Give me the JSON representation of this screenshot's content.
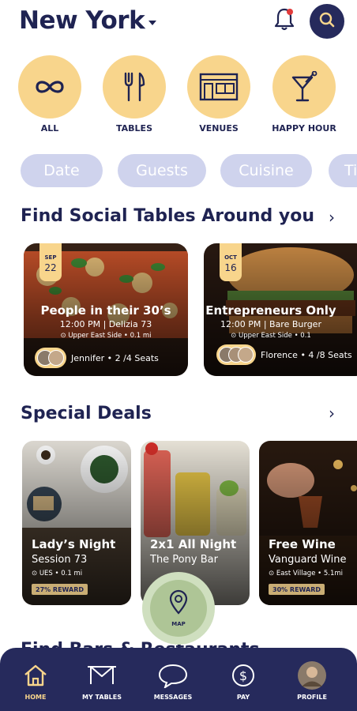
{
  "header": {
    "city": "New York"
  },
  "categories": [
    {
      "label": "ALL",
      "icon": "infinity-icon"
    },
    {
      "label": "TABLES",
      "icon": "fork-knife-icon"
    },
    {
      "label": "VENUES",
      "icon": "storefront-icon"
    },
    {
      "label": "HAPPY HOUR",
      "icon": "cocktail-icon"
    }
  ],
  "filters": [
    "Date",
    "Guests",
    "Cuisine",
    "Ti"
  ],
  "social_tables": {
    "title": "Find Social Tables Around you",
    "cards": [
      {
        "month": "SEP",
        "day": "22",
        "title": "People in their 30’s",
        "time_venue": "12:00 PM | Delizia 73",
        "location": "Upper East Side • 0.1 mi",
        "host": "Jennifer • 2 /4 Seats"
      },
      {
        "month": "OCT",
        "day": "16",
        "title": "Entrepreneurs Only",
        "time_venue": "12:00 PM | Bare Burger",
        "location": "Upper East Side • 0.1",
        "host": "Florence • 4 /8 Seats"
      }
    ]
  },
  "deals": {
    "title": "Special Deals",
    "cards": [
      {
        "title": "Lady’s Night",
        "subtitle": "Session 73",
        "location": "UES • 0.1 mi",
        "reward": "27% REWARD"
      },
      {
        "title": "2x1 All Night",
        "subtitle": "The Pony Bar",
        "location": "",
        "reward": ""
      },
      {
        "title": "Free Wine",
        "subtitle": "Vanguard Wine",
        "location": "East Village • 5.1mi",
        "reward": "30% REWARD"
      }
    ]
  },
  "bars_section": {
    "title": "Find Bars & Restaurants"
  },
  "map_fab": {
    "label": "MAP"
  },
  "bottom_nav": [
    {
      "label": "HOME",
      "icon": "home-icon",
      "active": true
    },
    {
      "label": "MY TABLES",
      "icon": "table-icon",
      "active": false
    },
    {
      "label": "MESSAGES",
      "icon": "chat-bubble-icon",
      "active": false
    },
    {
      "label": "PAY",
      "icon": "dollar-icon",
      "active": false
    },
    {
      "label": "PROFILE",
      "icon": "profile-avatar",
      "active": false
    }
  ],
  "colors": {
    "navy": "#262a5c",
    "accent_yellow": "#f8d58c",
    "pill_lavender": "#cfd3ed",
    "map_green": "#aec596"
  }
}
